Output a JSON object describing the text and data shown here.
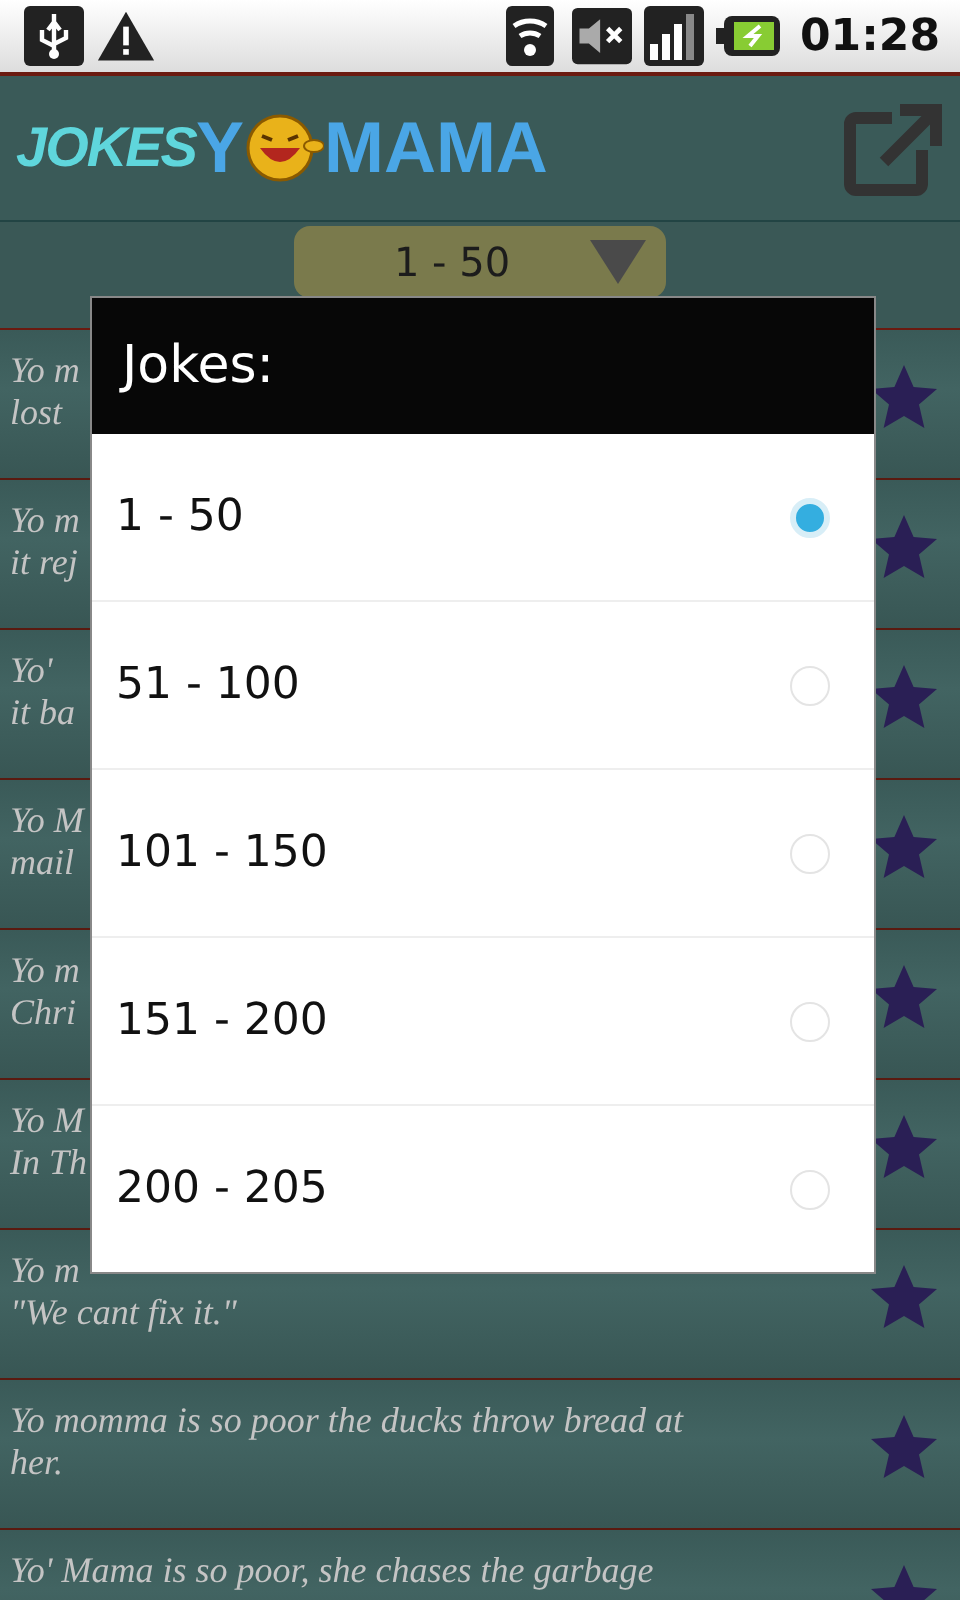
{
  "status_bar": {
    "time": "01:28"
  },
  "header": {
    "logo": [
      "JOKES",
      "Y",
      "MAMA"
    ]
  },
  "spinner": {
    "value": "1 - 50"
  },
  "jokes": [
    {
      "lines": [
        "Yo m",
        "lost"
      ]
    },
    {
      "lines": [
        "Yo m",
        "it rej"
      ]
    },
    {
      "lines": [
        "Yo'",
        "it ba"
      ]
    },
    {
      "lines": [
        "Yo M",
        "mail"
      ]
    },
    {
      "lines": [
        "Yo m",
        "Chri"
      ]
    },
    {
      "lines": [
        "Yo M",
        "In Th"
      ]
    },
    {
      "lines": [
        "Yo m",
        "\"We cant fix it.\""
      ]
    },
    {
      "lines": [
        "Yo momma is so poor the ducks throw bread at",
        "her."
      ]
    },
    {
      "lines": [
        "Yo' Mama is so poor, she chases the garbage"
      ]
    }
  ],
  "dialog": {
    "title": "Jokes:",
    "options": [
      {
        "label": "1 - 50",
        "selected": true
      },
      {
        "label": "51 - 100",
        "selected": false
      },
      {
        "label": "101 - 150",
        "selected": false
      },
      {
        "label": "151 - 200",
        "selected": false
      },
      {
        "label": "200 - 205",
        "selected": false
      }
    ]
  }
}
